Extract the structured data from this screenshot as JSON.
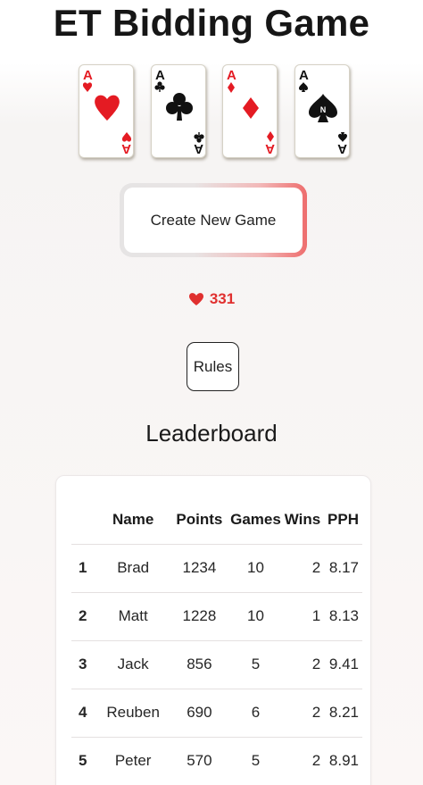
{
  "header": {
    "title": "ET Bidding Game"
  },
  "cards": [
    {
      "rank": "A",
      "suit": "hearts",
      "color": "#e41b23"
    },
    {
      "rank": "A",
      "suit": "clubs",
      "color": "#111111"
    },
    {
      "rank": "A",
      "suit": "diamonds",
      "color": "#e41b23"
    },
    {
      "rank": "A",
      "suit": "spades",
      "color": "#111111",
      "center_mark": "N"
    }
  ],
  "actions": {
    "create_label": "Create New Game",
    "rules_label": "Rules"
  },
  "likes": {
    "icon": "heart-icon",
    "count": "331",
    "color": "#e0302f"
  },
  "leaderboard": {
    "title": "Leaderboard",
    "columns": [
      "",
      "Name",
      "Points",
      "Games",
      "Wins",
      "PPH"
    ],
    "rows": [
      {
        "rank": "1",
        "name": "Brad",
        "points": "1234",
        "games": "10",
        "wins": "2",
        "pph": "8.17"
      },
      {
        "rank": "2",
        "name": "Matt",
        "points": "1228",
        "games": "10",
        "wins": "1",
        "pph": "8.13"
      },
      {
        "rank": "3",
        "name": "Jack",
        "points": "856",
        "games": "5",
        "wins": "2",
        "pph": "9.41"
      },
      {
        "rank": "4",
        "name": "Reuben",
        "points": "690",
        "games": "6",
        "wins": "2",
        "pph": "8.21"
      },
      {
        "rank": "5",
        "name": "Peter",
        "points": "570",
        "games": "5",
        "wins": "2",
        "pph": "8.91"
      }
    ]
  }
}
